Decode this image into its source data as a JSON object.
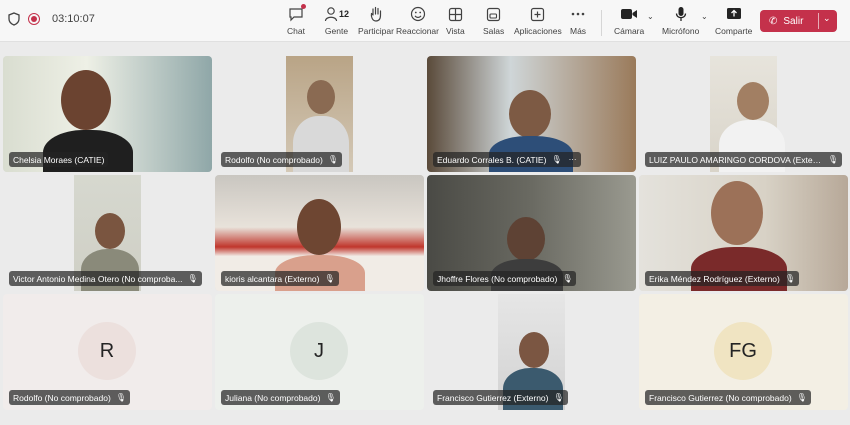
{
  "call": {
    "timer": "03:10:07"
  },
  "toolbar": {
    "chat": "Chat",
    "people": "Gente",
    "people_count": "12",
    "raise_hand": "Participar",
    "react": "Reaccionar",
    "view": "Vista",
    "rooms": "Salas",
    "apps": "Aplicaciones",
    "more": "Más",
    "camera": "Cámara",
    "mic": "Micrófono",
    "share": "Comparte",
    "leave": "Salir"
  },
  "icons": {
    "chat": "chat-icon",
    "people": "people-icon",
    "hand": "hand-icon",
    "react": "smile-icon",
    "view": "grid-icon",
    "rooms": "rooms-icon",
    "apps": "plus-icon",
    "more": "ellipsis-icon",
    "camera": "camera-icon",
    "mic": "microphone-icon",
    "share": "share-icon",
    "leave": "phone-icon"
  },
  "colors": {
    "leave": "#c4314b",
    "recording": "#c4314b",
    "namebar": "#242424"
  },
  "participants": [
    {
      "name": "Chelsia Moraes (CATIE)",
      "muted": false
    },
    {
      "name": "Rodolfo (No comprobado)",
      "muted": true
    },
    {
      "name": "Eduardo Corrales B. (CATIE)",
      "muted": true
    },
    {
      "name": "LUIZ PAULO AMARINGO CORDOVA (Externo)",
      "muted": true
    },
    {
      "name": "Victor Antonio Medina Otero (No comproba...",
      "muted": true
    },
    {
      "name": "kioris alcantara (Externo)",
      "muted": true
    },
    {
      "name": "Jhoffre Flores (No comprobado)",
      "muted": true
    },
    {
      "name": "Erika Méndez Rodríguez (Externo)",
      "muted": true
    },
    {
      "name": "Rodolfo (No comprobado)",
      "muted": true,
      "initials": "R"
    },
    {
      "name": "Juliana (No comprobado)",
      "muted": true,
      "initials": "J"
    },
    {
      "name": "Francisco Gutierrez (Externo)",
      "muted": true
    },
    {
      "name": "Francisco Gutierrez (No comprobado)",
      "muted": true,
      "initials": "FG"
    }
  ]
}
